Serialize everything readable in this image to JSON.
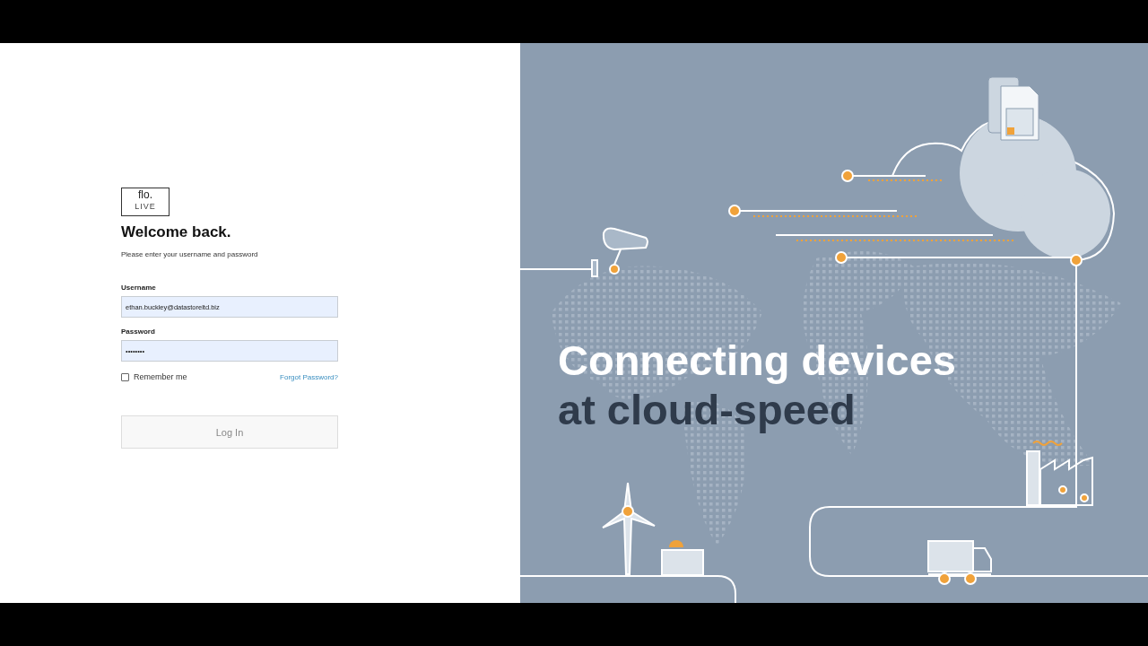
{
  "login": {
    "logo": {
      "mark": "flo.",
      "sub": "LIVE"
    },
    "title": "Welcome back.",
    "subtitle": "Please enter your username and password",
    "fields": [
      {
        "label": "Username",
        "value": "ethan.buckley@datastoreltd.biz"
      },
      {
        "label": "Password",
        "value": "••••••••"
      }
    ],
    "remember": {
      "label": "Remember me",
      "checked": false
    },
    "forgot_link": "Forgot Password?",
    "submit": "Log In"
  },
  "hero": {
    "lines": [
      {
        "text": "Connecting devices",
        "kind": "light"
      },
      {
        "text": "at cloud-speed",
        "kind": "dark"
      }
    ]
  }
}
